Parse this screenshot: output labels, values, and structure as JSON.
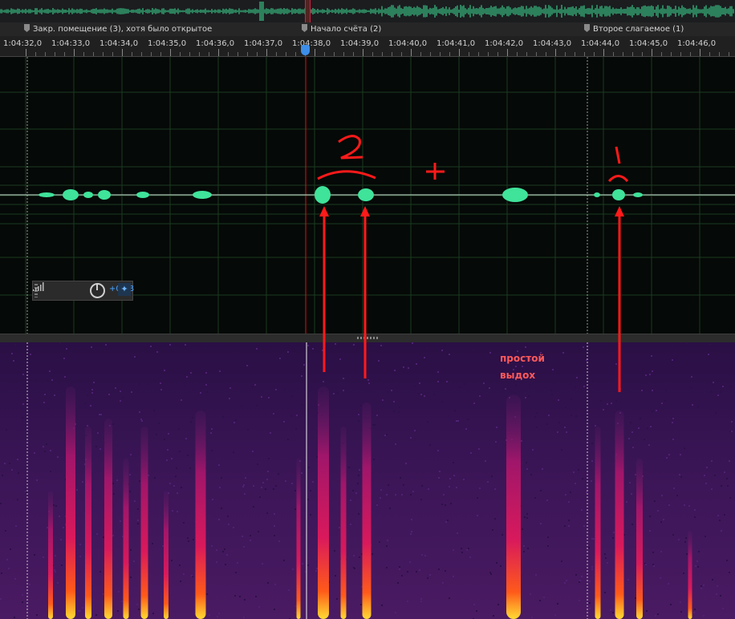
{
  "markers": [
    {
      "label": "Закр. помещение (3), хотя было открытое"
    },
    {
      "label": "Начало счёта (2)"
    },
    {
      "label": "Второе слагаемое (1)"
    }
  ],
  "ruler": {
    "labels": [
      "1:04:32,0",
      "1:04:33,0",
      "1:04:34,0",
      "1:04:35,0",
      "1:04:36,0",
      "1:04:37,0",
      "1:04:38,0",
      "1:04:39,0",
      "1:04:40,0",
      "1:04:41,0",
      "1:04:42,0",
      "1:04:43,0",
      "1:04:44,0",
      "1:04:45,0",
      "1:04:46,0"
    ]
  },
  "gain": {
    "value": "+0 dB"
  },
  "annotations": {
    "note_line1": "простой",
    "note_line2": "выдох",
    "digit_left": "2",
    "plus_sign": "+",
    "digit_right": "1"
  },
  "icons": {
    "level": "level-meter-icon",
    "knob": "gain-knob-icon",
    "pin": "pin-icon"
  },
  "colors": {
    "waveform": "#3fe39a",
    "annotation": "#ff1a1a",
    "playhead": "#3d8ee8",
    "gain_text": "#4aa3ff"
  }
}
